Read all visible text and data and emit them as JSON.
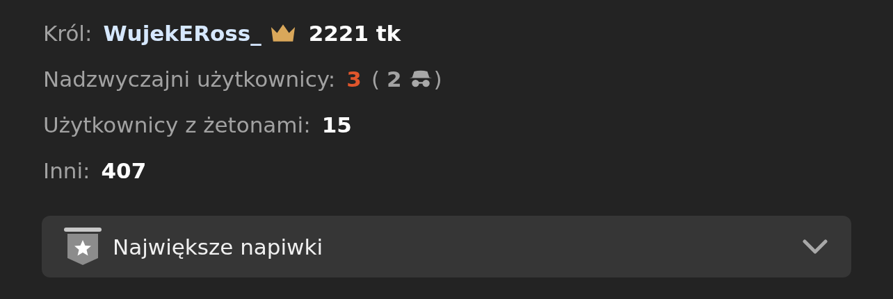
{
  "stats": [
    {
      "kind": "king",
      "label": "Król:",
      "name": "WujekERoss_",
      "value": "2221 tk",
      "color": "#ffffff"
    },
    {
      "kind": "count",
      "label": "Nadzwyczajni użytkownicy:",
      "value": "3",
      "color": "#e0562c",
      "hidden": {
        "open": "(",
        "count": "2",
        "close": ")"
      }
    },
    {
      "kind": "count",
      "label": "Użytkownicy z żetonami:",
      "value": "15",
      "color": "#ffffff"
    },
    {
      "kind": "count",
      "label": "Inni:",
      "value": "407",
      "color": "#ffffff"
    }
  ],
  "section": {
    "title": "Największe napiwki",
    "expanded": false
  }
}
